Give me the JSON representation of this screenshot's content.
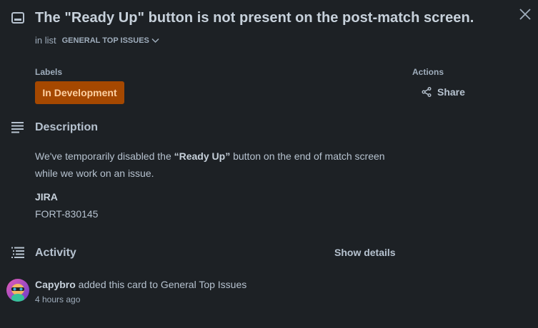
{
  "card": {
    "title": "The \"Ready Up\" button is not present on the post-match screen.",
    "in_list_prefix": "in list",
    "list_name": "GENERAL TOP ISSUES"
  },
  "labels": {
    "heading": "Labels",
    "items": [
      {
        "text": "In Development",
        "color": "#a54800",
        "text_color": "#fdd0a2"
      }
    ]
  },
  "actions": {
    "heading": "Actions",
    "share_label": "Share",
    "share_icon": "share-icon"
  },
  "description": {
    "heading": "Description",
    "text_before": "We've temporarily disabled the ",
    "text_bold": "“Ready Up”",
    "text_after": " button on the end of match screen while we work on an issue.",
    "jira_heading": "JIRA",
    "jira_value": "FORT-830145"
  },
  "activity": {
    "heading": "Activity",
    "show_details_label": "Show details",
    "entries": [
      {
        "author": "Capybro",
        "action": " added this card to General Top Issues",
        "time": "4 hours ago"
      }
    ]
  },
  "icons": {
    "card": "card-icon",
    "close": "close-icon",
    "description": "description-icon",
    "activity": "activity-icon"
  },
  "colors": {
    "background": "#1d2125",
    "text": "#b6c2cf",
    "label_orange": "#a54800"
  }
}
